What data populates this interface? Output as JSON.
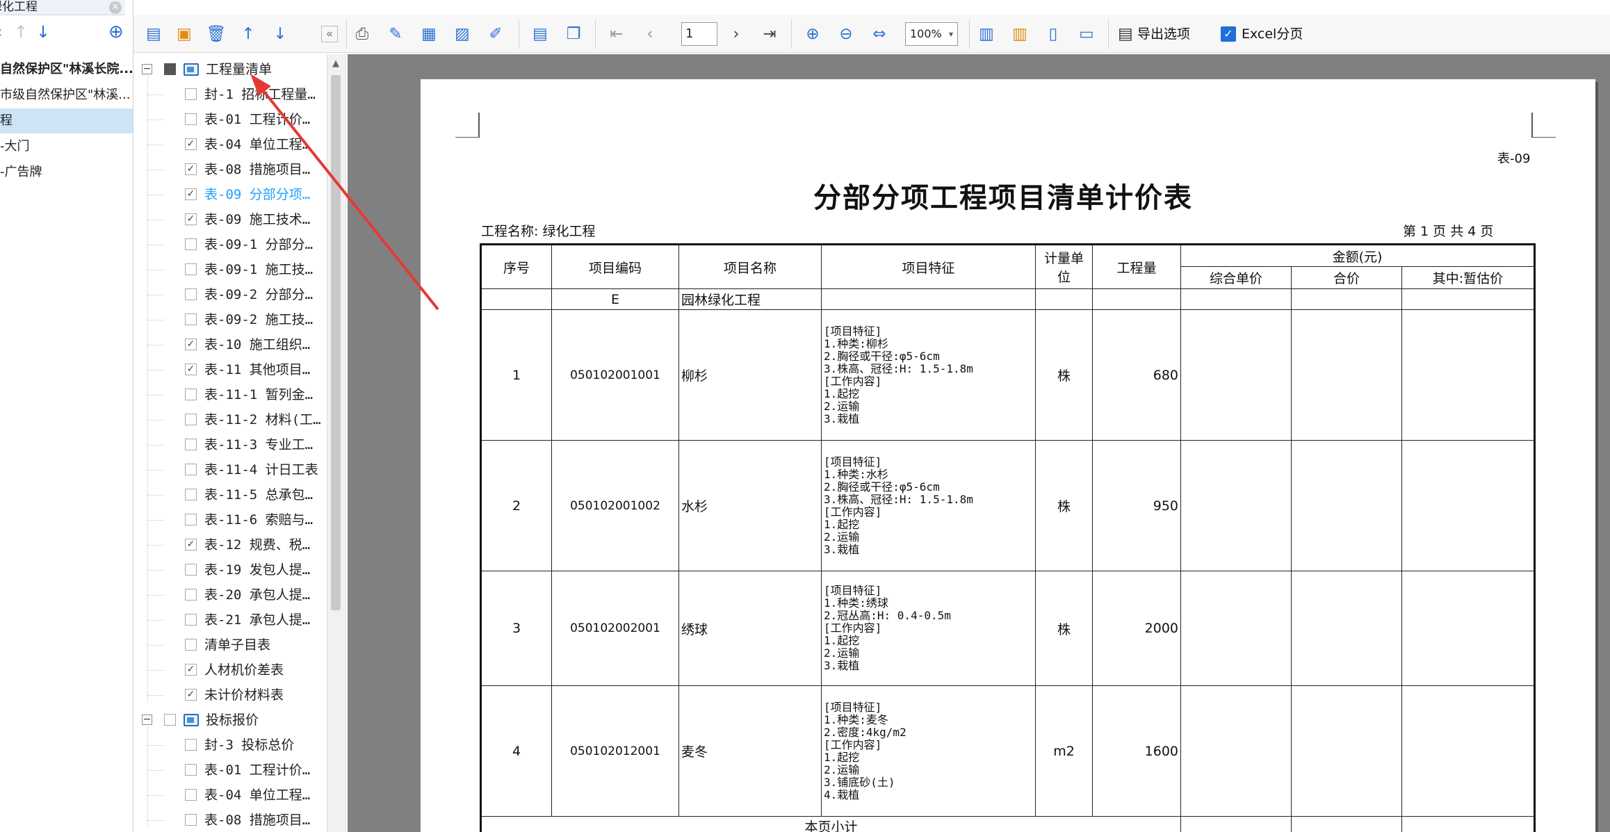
{
  "left_panel": {
    "tab_title": "绿化工程",
    "projects": [
      {
        "label": "自然保护区\"林溪长院...",
        "bold": true
      },
      {
        "label": "市级自然保护区\"林溪...",
        "bold": false
      },
      {
        "label": "程",
        "bold": false,
        "selected": true
      },
      {
        "label": "-大门",
        "bold": false
      },
      {
        "label": "-广告牌",
        "bold": false
      }
    ]
  },
  "toolbar": {
    "page_number": "1",
    "zoom": "100%",
    "export_label": "导出选项",
    "excel_label": "Excel分页",
    "excel_checked": true
  },
  "tree": {
    "group1_label": "工程量清单",
    "group2_label": "投标报价",
    "items1": [
      {
        "label": "封-1 招标工程量…",
        "checked": false
      },
      {
        "label": "表-01 工程计价…",
        "checked": false
      },
      {
        "label": "表-04 单位工程…",
        "checked": true
      },
      {
        "label": "表-08 措施项目…",
        "checked": true
      },
      {
        "label": "表-09 分部分项…",
        "checked": true,
        "current": true
      },
      {
        "label": "表-09 施工技术…",
        "checked": true
      },
      {
        "label": "表-09-1 分部分…",
        "checked": false
      },
      {
        "label": "表-09-1 施工技…",
        "checked": false
      },
      {
        "label": "表-09-2 分部分…",
        "checked": false
      },
      {
        "label": "表-09-2 施工技…",
        "checked": false
      },
      {
        "label": "表-10 施工组织…",
        "checked": true
      },
      {
        "label": "表-11 其他项目…",
        "checked": true
      },
      {
        "label": "表-11-1 暂列金…",
        "checked": false
      },
      {
        "label": "表-11-2 材料(工…",
        "checked": false
      },
      {
        "label": "表-11-3 专业工…",
        "checked": false
      },
      {
        "label": "表-11-4 计日工表",
        "checked": false
      },
      {
        "label": "表-11-5 总承包…",
        "checked": false
      },
      {
        "label": "表-11-6 索赔与…",
        "checked": false
      },
      {
        "label": "表-12 规费、税…",
        "checked": true
      },
      {
        "label": "表-19 发包人提…",
        "checked": false
      },
      {
        "label": "表-20 承包人提…",
        "checked": false
      },
      {
        "label": "表-21 承包人提…",
        "checked": false
      },
      {
        "label": "清单子目表",
        "checked": false
      },
      {
        "label": "人材机价差表",
        "checked": true
      },
      {
        "label": "未计价材料表",
        "checked": true
      }
    ],
    "items2": [
      {
        "label": "封-3 投标总价",
        "checked": false
      },
      {
        "label": "表-01 工程计价…",
        "checked": false
      },
      {
        "label": "表-04 单位工程…",
        "checked": false
      },
      {
        "label": "表-08 措施项目…",
        "checked": false
      }
    ]
  },
  "document": {
    "form_no": "表-09",
    "title": "分部分项工程项目清单计价表",
    "project_name": "工程名称: 绿化工程",
    "page_info": "第 1 页 共 4 页",
    "headers": {
      "seq": "序号",
      "code": "项目编码",
      "name": "项目名称",
      "feature": "项目特征",
      "unit": "计量单位",
      "qty": "工程量",
      "amount": "金额(元)",
      "unit_price": "综合单价",
      "total": "合价",
      "provisional": "其中:暂估价"
    },
    "section": {
      "code": "E",
      "name": "园林绿化工程"
    },
    "rows": [
      {
        "seq": "1",
        "code": "050102001001",
        "name": "柳杉",
        "feature": "[项目特征]\n1.种类:柳杉\n2.胸径或干径:φ5-6cm\n3.株高、冠径:H: 1.5-1.8m\n[工作内容]\n1.起挖\n2.运输\n3.栽植",
        "unit": "株",
        "qty": "680"
      },
      {
        "seq": "2",
        "code": "050102001002",
        "name": "水杉",
        "feature": "[项目特征]\n1.种类:水杉\n2.胸径或干径:φ5-6cm\n3.株高、冠径:H: 1.5-1.8m\n[工作内容]\n1.起挖\n2.运输\n3.栽植",
        "unit": "株",
        "qty": "950"
      },
      {
        "seq": "3",
        "code": "050102002001",
        "name": "绣球",
        "feature": "[项目特征]\n1.种类:绣球\n2.冠丛高:H: 0.4-0.5m\n[工作内容]\n1.起挖\n2.运输\n3.栽植",
        "unit": "株",
        "qty": "2000"
      },
      {
        "seq": "4",
        "code": "050102012001",
        "name": "麦冬",
        "feature": "[项目特征]\n1.种类:麦冬\n2.密度:4kg/m2\n[工作内容]\n1.起挖\n2.运输\n3.铺底砂(土)\n4.栽植",
        "unit": "m2",
        "qty": "1600"
      }
    ],
    "subtotal_label": "本页小计"
  },
  "colors": {
    "accent_blue": "#1ea1ff",
    "icon_blue": "#2d6db3",
    "arrow_red": "#e53935",
    "preview_bg": "#808080",
    "selected_row": "#cde4f7"
  }
}
